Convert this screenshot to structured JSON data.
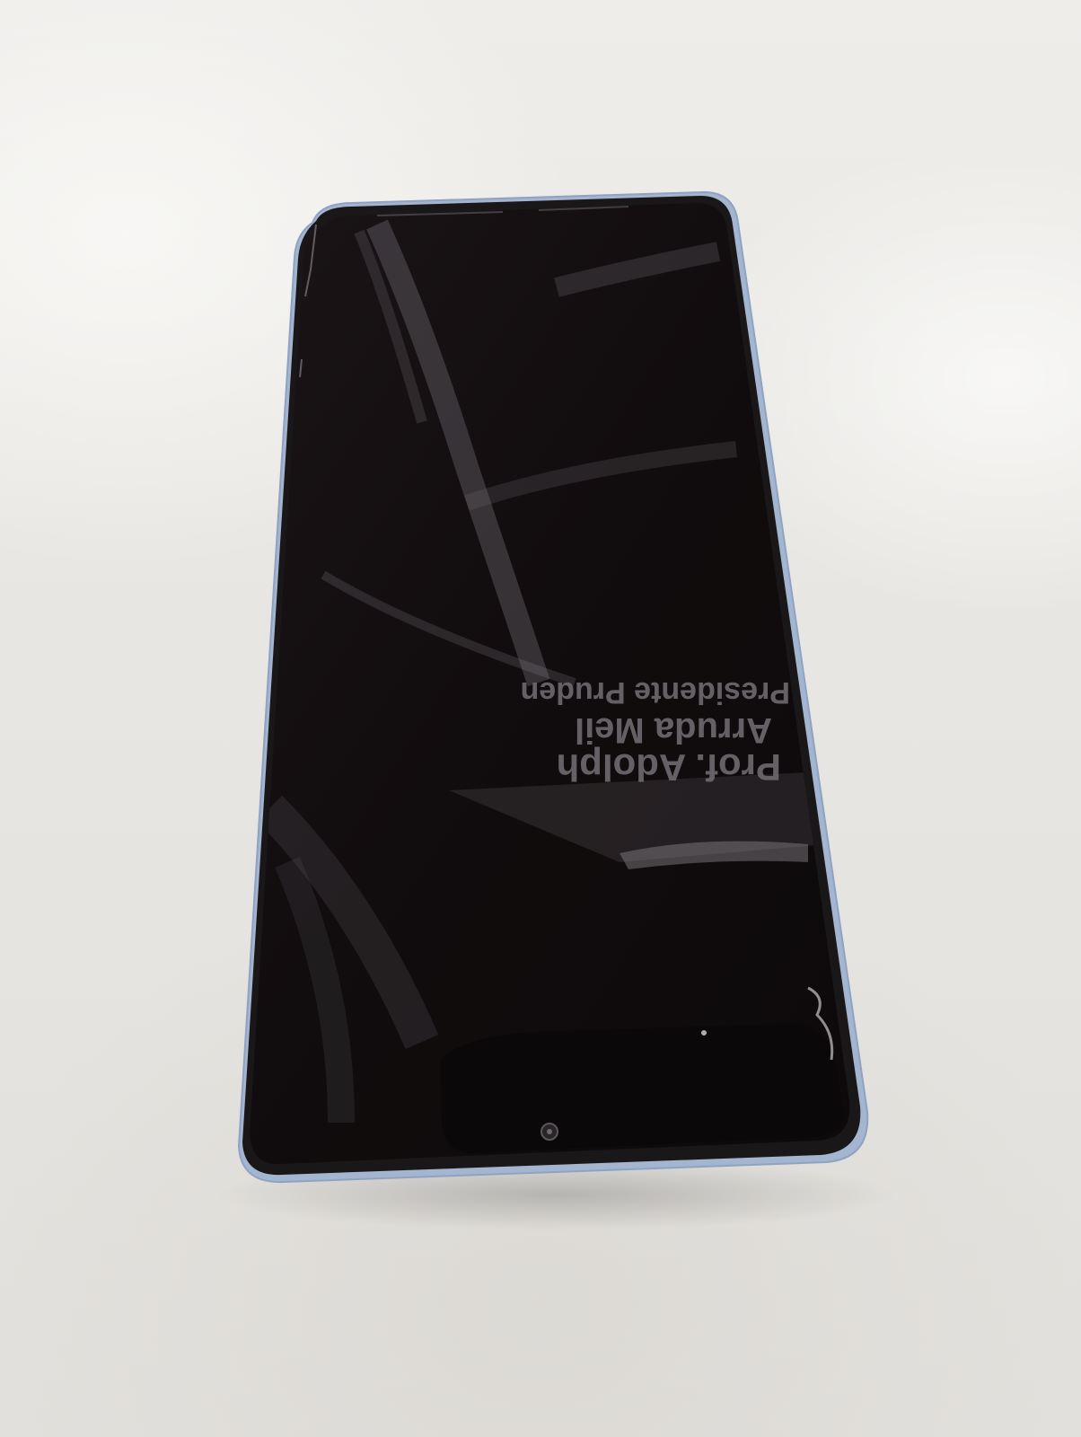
{
  "scene": {
    "subject": "smartphone",
    "table_color": "#ebe9e5",
    "phone_frame_color": "#9fb3cf",
    "screen_color": "#120d0e"
  },
  "reflection": {
    "line1": "Presidente Pruden",
    "line2": "Arruda Meil",
    "line3": "Prof. Adolph"
  }
}
